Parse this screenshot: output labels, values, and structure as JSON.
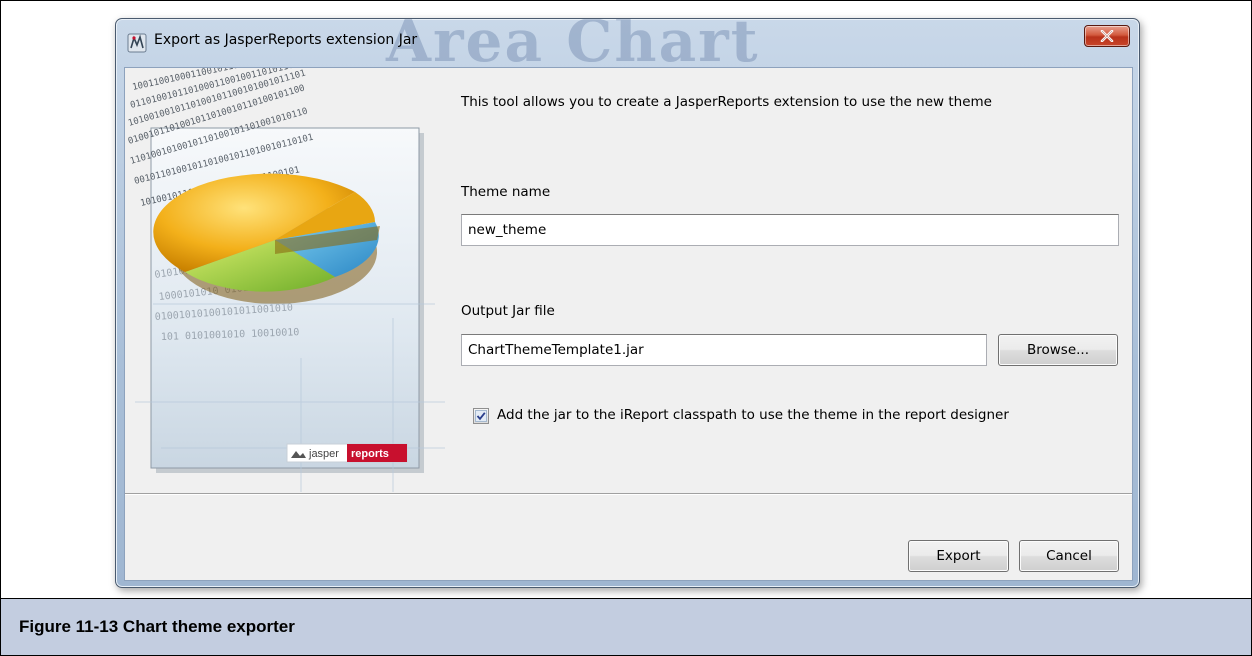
{
  "dialog": {
    "title": "Export as JasperReports extension Jar",
    "title_watermark": "Area Chart",
    "intro": "This tool allows you to create a JasperReports extension to use the new theme",
    "theme_name_label": "Theme name",
    "theme_name_value": "new_theme",
    "output_jar_label": "Output Jar file",
    "output_jar_value": "ChartThemeTemplate1.jar",
    "browse_label": "Browse...",
    "classpath_checkbox_label": "Add the jar to the iReport classpath to use the theme in the report designer",
    "classpath_checked": true,
    "export_label": "Export",
    "cancel_label": "Cancel"
  },
  "banner": {
    "logo_left": "jasper",
    "logo_right": "reports"
  },
  "caption": "Figure 11-13  Chart theme exporter",
  "colors": {
    "caption_bg": "#c3cde0",
    "titlebar": "#b4c8df",
    "close_button": "#c9452a",
    "logo_red": "#c8102e"
  },
  "icons": {
    "app": "ireport-app-icon",
    "close": "close-icon",
    "check": "checkmark-icon"
  }
}
